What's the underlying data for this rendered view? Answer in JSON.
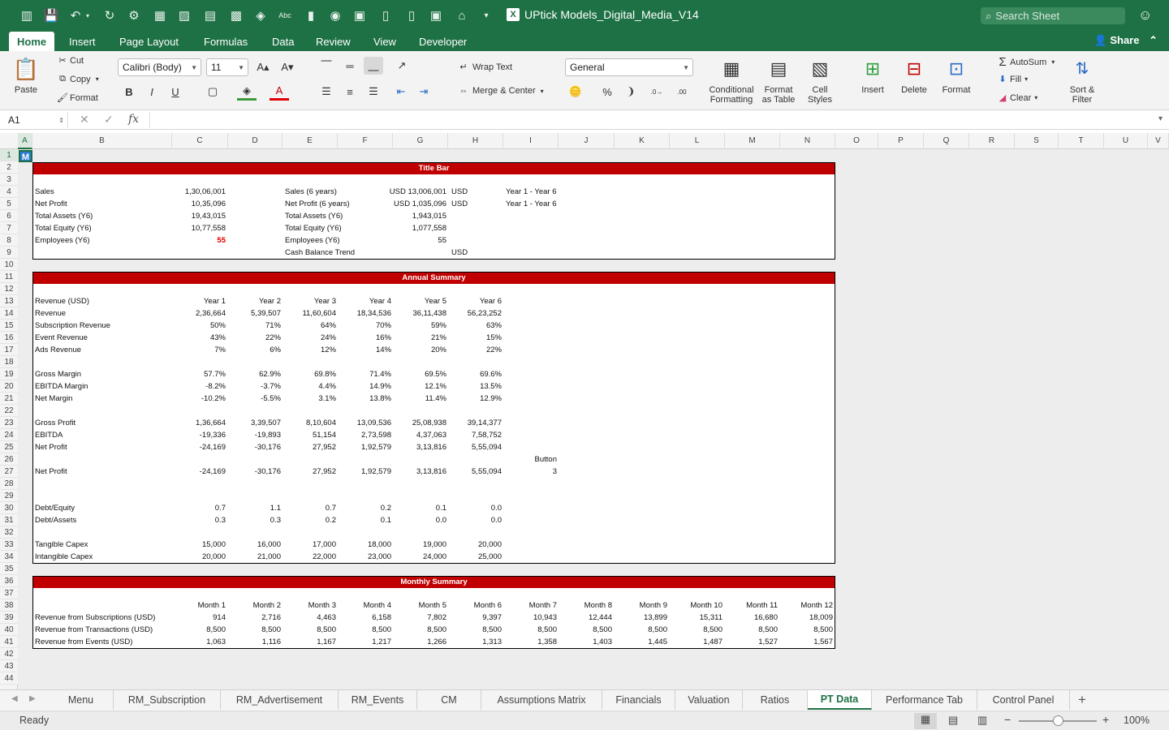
{
  "app": {
    "title": "UPtick Models_Digital_Media_V14",
    "search_placeholder": "Search Sheet",
    "accent": "#1e7145"
  },
  "ribbon_tabs": [
    "Home",
    "Insert",
    "Page Layout",
    "Formulas",
    "Data",
    "Review",
    "View",
    "Developer"
  ],
  "share_label": "Share",
  "ribbon": {
    "paste": "Paste",
    "cut": "Cut",
    "copy": "Copy",
    "format": "Format",
    "font_name": "Calibri (Body)",
    "font_size": "11",
    "wrap_text": "Wrap Text",
    "merge_center": "Merge & Center",
    "number_format": "General",
    "conditional_formatting": [
      "Conditional",
      "Formatting"
    ],
    "format_as_table": [
      "Format",
      "as Table"
    ],
    "cell_styles": [
      "Cell",
      "Styles"
    ],
    "insert": "Insert",
    "delete": "Delete",
    "format_cells": "Format",
    "autosum": "AutoSum",
    "fill": "Fill",
    "clear": "Clear",
    "sort_filter": [
      "Sort &",
      "Filter"
    ]
  },
  "formula_bar": {
    "name_box": "A1",
    "fx": "fx",
    "formula": ""
  },
  "columns": [
    "A",
    "B",
    "C",
    "D",
    "E",
    "F",
    "G",
    "H",
    "I",
    "J",
    "K",
    "L",
    "M",
    "N",
    "O",
    "P",
    "Q",
    "R",
    "S",
    "T",
    "U",
    "V"
  ],
  "rows": [
    "1",
    "2",
    "3",
    "4",
    "5",
    "6",
    "7",
    "8",
    "9",
    "10",
    "11",
    "12",
    "13",
    "14",
    "15",
    "16",
    "17",
    "18",
    "19",
    "20",
    "21",
    "22",
    "23",
    "24",
    "25",
    "26",
    "27",
    "28",
    "29",
    "30",
    "31",
    "32",
    "33",
    "34",
    "35",
    "36",
    "37",
    "38",
    "39",
    "40",
    "41",
    "42",
    "43",
    "44"
  ],
  "a1_value": "M",
  "title_bar": {
    "heading": "Title Bar",
    "left": [
      {
        "label": "Sales",
        "value": "1,30,06,001"
      },
      {
        "label": "Net Profit",
        "value": "10,35,096"
      },
      {
        "label": "Total Assets (Y6)",
        "value": "19,43,015"
      },
      {
        "label": "Total Equity (Y6)",
        "value": "10,77,558"
      },
      {
        "label": "Employees (Y6)",
        "value": "55"
      }
    ],
    "right": [
      {
        "label": "Sales (6 years)",
        "value": "USD 13,006,001",
        "unit": "USD",
        "note": "Year 1 - Year 6"
      },
      {
        "label": "Net Profit (6 years)",
        "value": "USD 1,035,096",
        "unit": "USD",
        "note": "Year 1 - Year 6"
      },
      {
        "label": "Total Assets (Y6)",
        "value": "1,943,015",
        "unit": "",
        "note": ""
      },
      {
        "label": "Total Equity (Y6)",
        "value": "1,077,558",
        "unit": "",
        "note": ""
      },
      {
        "label": "Employees (Y6)",
        "value": "55",
        "unit": "",
        "note": ""
      },
      {
        "label": "Cash Balance Trend",
        "value": "",
        "unit": "USD",
        "note": ""
      }
    ]
  },
  "annual_summary": {
    "heading": "Annual Summary",
    "header_label": "Revenue (USD)",
    "years": [
      "Year 1",
      "Year 2",
      "Year 3",
      "Year 4",
      "Year 5",
      "Year 6"
    ],
    "rows": [
      {
        "row": 14,
        "label": "Revenue",
        "values": [
          "2,36,664",
          "5,39,507",
          "11,60,604",
          "18,34,536",
          "36,11,438",
          "56,23,252"
        ]
      },
      {
        "row": 15,
        "label": "Subscription Revenue",
        "values": [
          "50%",
          "71%",
          "64%",
          "70%",
          "59%",
          "63%"
        ]
      },
      {
        "row": 16,
        "label": "Event Revenue",
        "values": [
          "43%",
          "22%",
          "24%",
          "16%",
          "21%",
          "15%"
        ]
      },
      {
        "row": 17,
        "label": "Ads Revenue",
        "values": [
          "7%",
          "6%",
          "12%",
          "14%",
          "20%",
          "22%"
        ]
      },
      {
        "row": 19,
        "label": "Gross Margin",
        "values": [
          "57.7%",
          "62.9%",
          "69.8%",
          "71.4%",
          "69.5%",
          "69.6%"
        ]
      },
      {
        "row": 20,
        "label": "EBITDA Margin",
        "values": [
          "-8.2%",
          "-3.7%",
          "4.4%",
          "14.9%",
          "12.1%",
          "13.5%"
        ]
      },
      {
        "row": 21,
        "label": "Net Margin",
        "values": [
          "-10.2%",
          "-5.5%",
          "3.1%",
          "13.8%",
          "11.4%",
          "12.9%"
        ]
      },
      {
        "row": 23,
        "label": "Gross Profit",
        "values": [
          "1,36,664",
          "3,39,507",
          "8,10,604",
          "13,09,536",
          "25,08,938",
          "39,14,377"
        ]
      },
      {
        "row": 24,
        "label": "EBITDA",
        "values": [
          "-19,336",
          "-19,893",
          "51,154",
          "2,73,598",
          "4,37,063",
          "7,58,752"
        ]
      },
      {
        "row": 25,
        "label": "Net Profit",
        "values": [
          "-24,169",
          "-30,176",
          "27,952",
          "1,92,579",
          "3,13,816",
          "5,55,094"
        ]
      },
      {
        "row": 27,
        "label": "Net Profit",
        "values": [
          "-24,169",
          "-30,176",
          "27,952",
          "1,92,579",
          "3,13,816",
          "5,55,094"
        ]
      },
      {
        "row": 30,
        "label": "Debt/Equity",
        "values": [
          "0.7",
          "1.1",
          "0.7",
          "0.2",
          "0.1",
          "0.0"
        ]
      },
      {
        "row": 31,
        "label": "Debt/Assets",
        "values": [
          "0.3",
          "0.3",
          "0.2",
          "0.1",
          "0.0",
          "0.0"
        ]
      },
      {
        "row": 33,
        "label": "Tangible Capex",
        "values": [
          "15,000",
          "16,000",
          "17,000",
          "18,000",
          "19,000",
          "20,000"
        ]
      },
      {
        "row": 34,
        "label": "Intangible Capex",
        "values": [
          "20,000",
          "21,000",
          "22,000",
          "23,000",
          "24,000",
          "25,000"
        ]
      }
    ],
    "button_label": "Button",
    "button_value": "3"
  },
  "monthly_summary": {
    "heading": "Monthly Summary",
    "months": [
      "Month 1",
      "Month 2",
      "Month 3",
      "Month 4",
      "Month 5",
      "Month 6",
      "Month 7",
      "Month 8",
      "Month 9",
      "Month 10",
      "Month 11",
      "Month 12"
    ],
    "rows": [
      {
        "label": "Revenue from Subscriptions (USD)",
        "values": [
          "914",
          "2,716",
          "4,463",
          "6,158",
          "7,802",
          "9,397",
          "10,943",
          "12,444",
          "13,899",
          "15,311",
          "16,680",
          "18,009"
        ]
      },
      {
        "label": "Revenue from Transactions (USD)",
        "values": [
          "8,500",
          "8,500",
          "8,500",
          "8,500",
          "8,500",
          "8,500",
          "8,500",
          "8,500",
          "8,500",
          "8,500",
          "8,500",
          "8,500"
        ]
      },
      {
        "label": "Revenue from Events (USD)",
        "values": [
          "1,063",
          "1,116",
          "1,167",
          "1,217",
          "1,266",
          "1,313",
          "1,358",
          "1,403",
          "1,445",
          "1,487",
          "1,527",
          "1,567"
        ]
      }
    ]
  },
  "sheet_tabs": [
    "Menu",
    "RM_Subscription",
    "RM_Advertisement",
    "RM_Events",
    "CM",
    "Assumptions Matrix",
    "Financials",
    "Valuation",
    "Ratios",
    "PT Data",
    "Performance Tab",
    "Control Panel"
  ],
  "active_sheet": "PT Data",
  "status": {
    "ready": "Ready",
    "zoom": "100%"
  }
}
